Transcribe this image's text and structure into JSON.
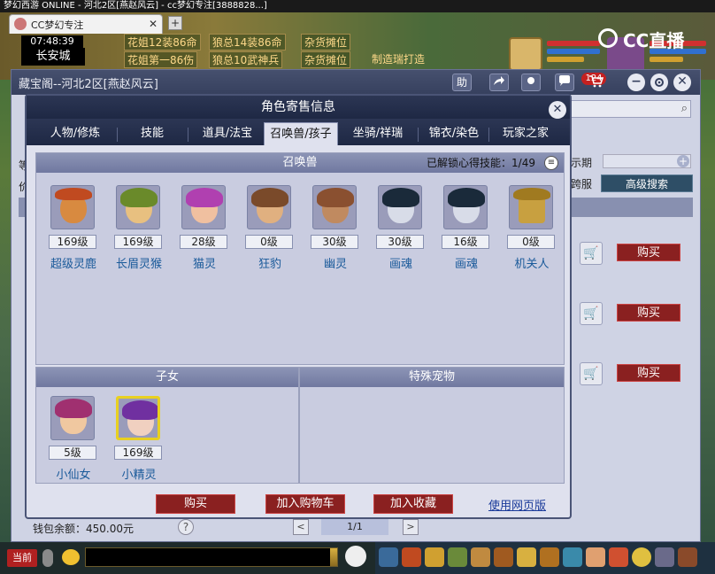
{
  "browser": {
    "strip_text": "梦幻西游 ONLINE - 河北2区[燕赵风云] - cc梦幻专注[3888828...]",
    "tab_title": "CC梦幻专注",
    "tab_close": "✕",
    "new_tab": "+"
  },
  "game_header": {
    "time": "07:48:39",
    "city": "长安城",
    "ticker": [
      "花姐12装86命",
      "狼总14装86命",
      "杂货摊位",
      "花姐第一86伤",
      "狼总10武神兵",
      "杂货摊位",
      "制造瑞打造"
    ],
    "cc_logo": "CC直播"
  },
  "bg_window": {
    "title": "藏宝阁--河北2区[燕赵风云]",
    "help_btn": "助",
    "share_icon": "share-icon",
    "cart_count": "124",
    "period_label": "示期",
    "cross_server_label": "跨服",
    "adv_search": "高级搜索",
    "buy": "购买",
    "wallet": "钱包余额：450.00元",
    "help": "?",
    "prev": "<",
    "page": "1/1",
    "next": ">",
    "left_labels": [
      "等",
      "价"
    ]
  },
  "modal": {
    "title": "角色寄售信息",
    "close": "✕",
    "tabs": [
      "人物/修炼",
      "技能",
      "道具/法宝",
      "召唤兽/孩子",
      "坐骑/祥瑞",
      "锦衣/染色",
      "玩家之家"
    ],
    "active_tab": 3,
    "summons_header": "召唤兽",
    "unlock_label": "已解锁心得技能：",
    "unlock_value": "1/49",
    "pets": [
      {
        "level": "169级",
        "name": "超级灵鹿"
      },
      {
        "level": "169级",
        "name": "长眉灵猴"
      },
      {
        "level": "28级",
        "name": "猫灵"
      },
      {
        "level": "0级",
        "name": "狂豹"
      },
      {
        "level": "30级",
        "name": "幽灵"
      },
      {
        "level": "30级",
        "name": "画魂"
      },
      {
        "level": "16级",
        "name": "画魂"
      },
      {
        "level": "0级",
        "name": "机关人"
      }
    ],
    "children_header": "子女",
    "special_header": "特殊宠物",
    "children": [
      {
        "level": "5级",
        "name": "小仙女"
      },
      {
        "level": "169级",
        "name": "小精灵"
      }
    ],
    "footer": {
      "buy": "购买",
      "add_cart": "加入购物车",
      "add_fav": "加入收藏",
      "web_version": "使用网页版"
    }
  },
  "bottom_bar": {
    "current": "当前"
  },
  "colors": {
    "accent_red": "#8a2020",
    "title_navy": "#2c3654",
    "link_blue": "#1a5a9a"
  }
}
